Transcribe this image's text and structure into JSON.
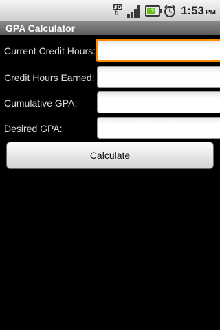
{
  "status_bar": {
    "network_type": "3G",
    "time": "1:53",
    "ampm": "PM",
    "icons": [
      "3g-icon",
      "signal-icon",
      "battery-charging-icon",
      "alarm-icon"
    ],
    "battery_level": 0.75
  },
  "app": {
    "title": "GPA Calculator"
  },
  "form": {
    "fields": [
      {
        "label": "Current Credit Hours:",
        "value": "",
        "focused": true
      },
      {
        "label": "Credit Hours Earned:",
        "value": "",
        "focused": false
      },
      {
        "label": "Cumulative GPA:",
        "value": "",
        "focused": false
      },
      {
        "label": "Desired GPA:",
        "value": "",
        "focused": false
      }
    ],
    "submit_label": "Calculate"
  },
  "colors": {
    "background": "#000000",
    "focus_ring": "#ff8a00",
    "title_bar": "#6e6e6e",
    "label_text": "#dcdcdc"
  }
}
